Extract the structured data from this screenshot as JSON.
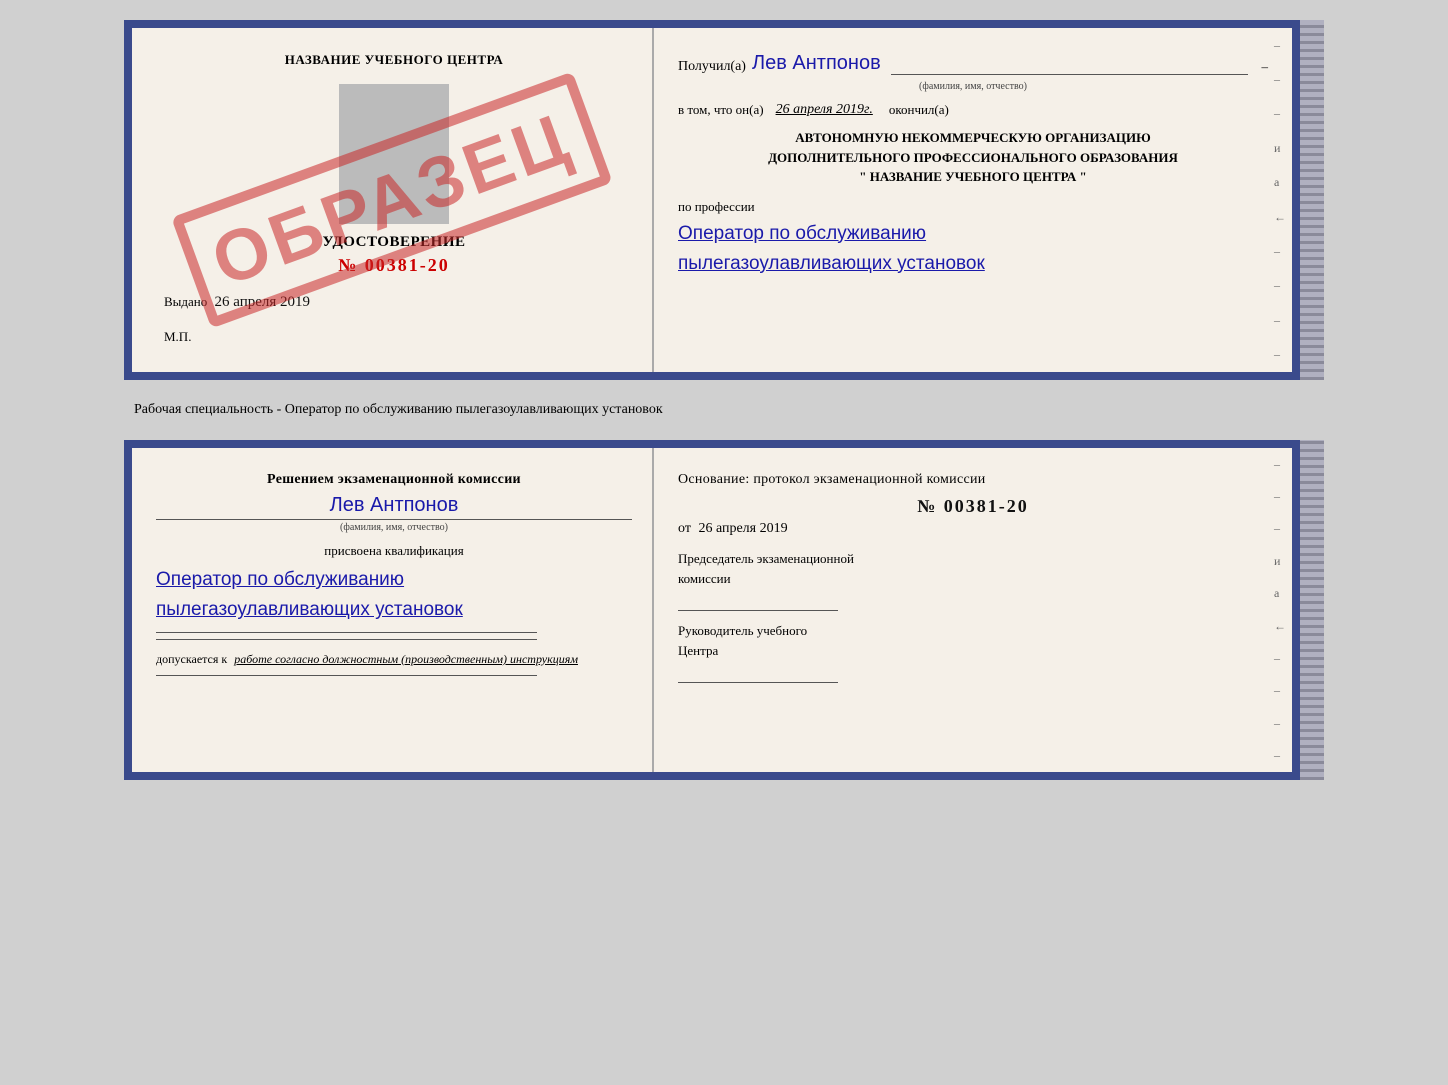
{
  "top": {
    "left": {
      "school_name": "НАЗВАНИЕ УЧЕБНОГО ЦЕНТРА",
      "stamp": "ОБРАЗЕЦ",
      "udostoverenie": "УДОСТОВЕРЕНИЕ",
      "number": "№ 00381-20",
      "vydano_prefix": "Выдано",
      "vydano_date": "26 апреля 2019",
      "mp": "М.П."
    },
    "right": {
      "poluchil_prefix": "Получил(а)",
      "recipient_name": "Лев Антпонов",
      "fio_label": "(фамилия, имя, отчество)",
      "v_tom_prefix": "в том, что он(а)",
      "date_value": "26 апреля 2019г.",
      "okonchil": "окончил(а)",
      "org_line1": "АВТОНОМНУЮ НЕКОММЕРЧЕСКУЮ ОРГАНИЗАЦИЮ",
      "org_line2": "ДОПОЛНИТЕЛЬНОГО ПРОФЕССИОНАЛЬНОГО ОБРАЗОВАНИЯ",
      "org_line3": "\"  НАЗВАНИЕ УЧЕБНОГО ЦЕНТРА  \"",
      "po_professii": "по профессии",
      "profession_line1": "Оператор по обслуживанию",
      "profession_line2": "пылегазоулавливающих установок"
    }
  },
  "separator": {
    "text": "Рабочая специальность - Оператор по обслуживанию пылегазоулавливающих установок"
  },
  "bottom": {
    "left": {
      "resheniem": "Решением экзаменационной комиссии",
      "recipient_name": "Лев Антпонов",
      "fio_label": "(фамилия, имя, отчество)",
      "prisvoena": "присвоена квалификация",
      "qualification_line1": "Оператор по обслуживанию",
      "qualification_line2": "пылегазоулавливающих установок",
      "dopuskaetsya_prefix": "допускается к",
      "dopuskaetsya_text": "работе согласно должностным (производственным) инструкциям"
    },
    "right": {
      "osnovanie": "Основание: протокол экзаменационной комиссии",
      "protocol_number": "№  00381-20",
      "ot_prefix": "от",
      "ot_date": "26 апреля 2019",
      "predsedatel_line1": "Председатель экзаменационной",
      "predsedatel_line2": "комиссии",
      "rukovoditel_line1": "Руководитель учебного",
      "rukovoditel_line2": "Центра"
    }
  },
  "dashes": [
    "-",
    "-",
    "-",
    "и",
    "а",
    "←",
    "-",
    "-",
    "-",
    "-",
    "-"
  ]
}
